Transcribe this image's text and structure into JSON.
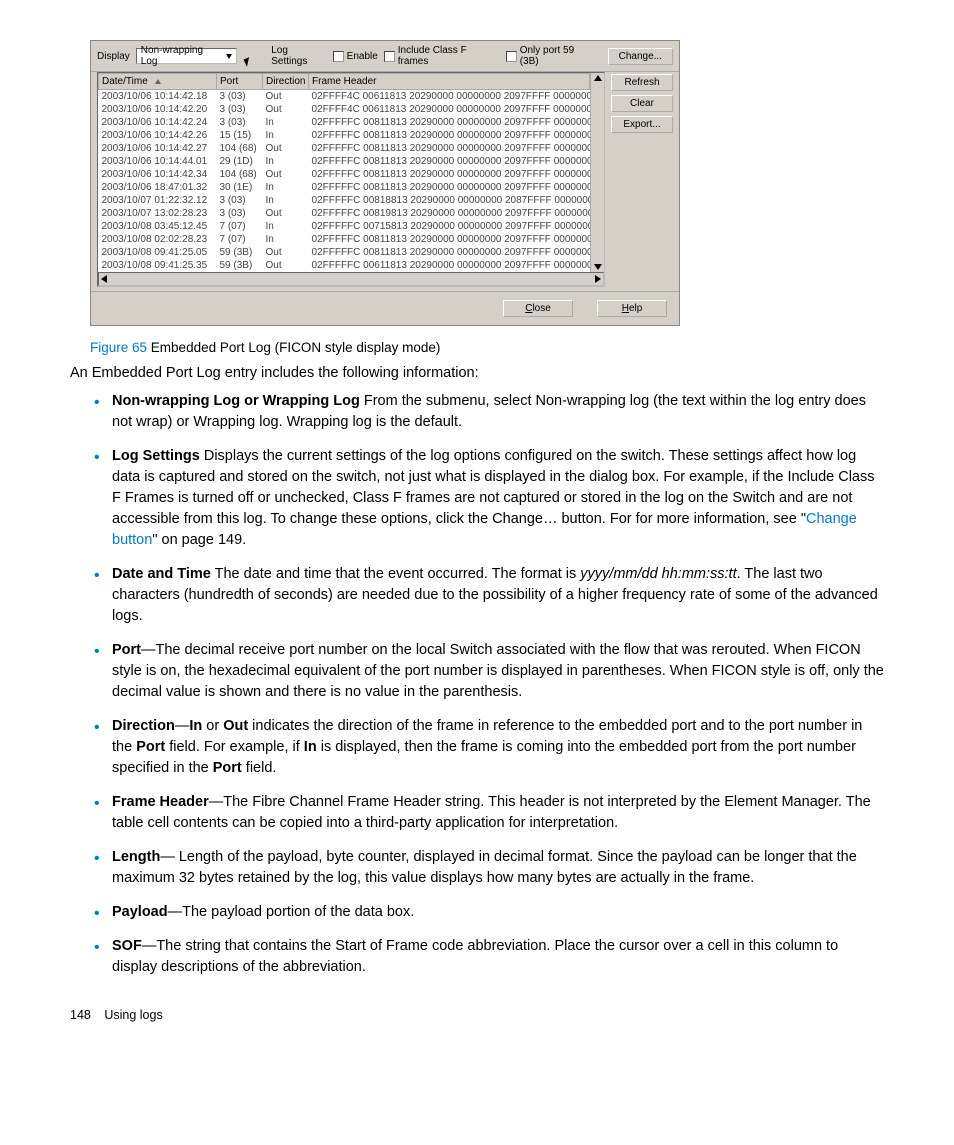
{
  "window": {
    "display_label": "Display",
    "dropdown": "Non-wrapping Log",
    "log_settings_label": "Log Settings",
    "enable_label": "Enable",
    "include_classf_label": "Include Class F frames",
    "only_port_label": "Only port 59 (3B)",
    "change_btn": "Change...",
    "columns": {
      "c0": "Date/Time",
      "c1": "Port",
      "c2": "Direction",
      "c3": "Frame Header"
    },
    "rows": [
      {
        "dt": "2003/10/06 10:14:42.18",
        "port": "3 (03)",
        "dir": "Out",
        "fh": "02FFFF4C 00611813 20290000 00000000 2097FFFF 0000000"
      },
      {
        "dt": "2003/10/06 10:14:42.20",
        "port": "3 (03)",
        "dir": "Out",
        "fh": "02FFFF4C 00611813 20290000 00000000 2097FFFF 0000000"
      },
      {
        "dt": "2003/10/06 10:14:42.24",
        "port": "3 (03)",
        "dir": "In",
        "fh": "02FFFFFC 00811813 20290000 00000000 2097FFFF 0000000"
      },
      {
        "dt": "2003/10/06 10:14:42.26",
        "port": "15 (15)",
        "dir": "In",
        "fh": "02FFFFFC 00811813 20290000 00000000 2097FFFF 0000000"
      },
      {
        "dt": "2003/10/06 10:14:42.27",
        "port": "104 (68)",
        "dir": "Out",
        "fh": "02FFFFFC 00811813 20290000 00000000 2097FFFF 0000000"
      },
      {
        "dt": "2003/10/06 10:14:44.01",
        "port": "29 (1D)",
        "dir": "In",
        "fh": "02FFFFFC 00811813 20290000 00000000 2097FFFF 0000000"
      },
      {
        "dt": "2003/10/06 10:14:42.34",
        "port": "104 (68)",
        "dir": "Out",
        "fh": "02FFFFFC 00811813 20290000 00000000 2097FFFF 0000000"
      },
      {
        "dt": "2003/10/06 18:47:01.32",
        "port": "30 (1E)",
        "dir": "In",
        "fh": "02FFFFFC 00811813 20290000 00000000 2097FFFF 0000000"
      },
      {
        "dt": "2003/10/07 01:22:32.12",
        "port": "3 (03)",
        "dir": "In",
        "fh": "02FFFFFC 00818813 20290000 00000000 2087FFFF 0000000"
      },
      {
        "dt": "2003/10/07 13:02:28.23",
        "port": "3 (03)",
        "dir": "Out",
        "fh": "02FFFFFC 00819813 20290000 00000000 2097FFFF 0000000"
      },
      {
        "dt": "2003/10/08 03:45:12.45",
        "port": "7 (07)",
        "dir": "In",
        "fh": "02FFFFFC 00715813 20290000 00000000 2097FFFF 0000000"
      },
      {
        "dt": "2003/10/08 02:02:28.23",
        "port": "7 (07)",
        "dir": "In",
        "fh": "02FFFFFC 00811813 20290000 00000000 2097FFFF 0000000"
      },
      {
        "dt": "2003/10/08 09:41:25.05",
        "port": "59 (3B)",
        "dir": "Out",
        "fh": "02FFFFFC 00811813 20290000 00000000 2097FFFF 0000000"
      },
      {
        "dt": "2003/10/08 09:41:25.35",
        "port": "59 (3B)",
        "dir": "Out",
        "fh": "02FFFFFC 00611813 20290000 00000000 2097FFFF 0000000"
      }
    ],
    "refresh_btn": "Refresh",
    "clear_btn": "Clear",
    "export_btn": "Export...",
    "close_btn": "Close",
    "help_btn": "Help"
  },
  "caption": {
    "prefix": "Figure 65",
    "text": "  Embedded Port Log (FICON style display mode)"
  },
  "intro": "An Embedded Port Log entry includes the following information:",
  "items": {
    "i0": {
      "term": "Non-wrapping Log or Wrapping Log",
      "sep": "   ",
      "body": "From the submenu, select Non-wrapping log (the text within the log entry does not wrap) or Wrapping log. Wrapping log is the default."
    },
    "i1": {
      "term": "Log Settings",
      "sep": "   ",
      "body_a": "Displays the current settings of the log options configured on the switch. These settings affect how log data is captured and stored on the switch, not just what is displayed in the dialog box. For example, if the Include Class F Frames is turned off or unchecked, Class F frames are not captured or stored in the log on the Switch and are not accessible from this log. To change these options, click the Change… button. For for more information, see \"",
      "link": "Change button",
      "body_b": "\" on page 149."
    },
    "i2": {
      "term": "Date and Time",
      "sep": "   ",
      "body_a": "The date and time that the event occurred. The format is ",
      "fmt": "yyyy/mm/dd hh:mm:ss:tt",
      "body_b": ". The last two characters (hundredth of seconds) are needed due to the possibility of a higher frequency rate of some of the advanced logs."
    },
    "i3": {
      "term": "Port",
      "sep": "—",
      "body": "The decimal receive port number on the local Switch associated with the flow that was rerouted. When FICON style is on, the hexadecimal equivalent of the port number is displayed in parentheses. When FICON style is off, only the decimal value is shown and there is no value in the parenthesis."
    },
    "i4": {
      "term": "Direction",
      "sep": "—",
      "body_a": "",
      "bold1": "In",
      "mid1": " or ",
      "bold2": "Out",
      "body_b": " indicates the direction of the frame in reference to the embedded port and to the port number in the ",
      "bold3": "Port",
      "body_c": " field. For example, if ",
      "bold4": "In",
      "body_d": " is displayed, then the frame is coming into the embedded port from the port number specified in the ",
      "bold5": "Port",
      "body_e": " field."
    },
    "i5": {
      "term": "Frame Header",
      "sep": "—",
      "body": "The Fibre Channel Frame Header string. This header is not interpreted by the Element Manager. The table cell contents can be copied into a third-party application for interpretation."
    },
    "i6": {
      "term": "Length",
      "sep": "— ",
      "body": "Length of the payload, byte counter, displayed in decimal format. Since the payload can be longer that the maximum 32 bytes retained by the log, this value displays how many bytes are actually in the frame."
    },
    "i7": {
      "term": "Payload",
      "sep": "—",
      "body": "The payload portion of the data box."
    },
    "i8": {
      "term": "SOF",
      "sep": "—",
      "body": "The string that contains the Start of Frame code abbreviation. Place the cursor over a cell in this column to display descriptions of the abbreviation."
    }
  },
  "footer": {
    "page": "148",
    "section": "Using logs"
  }
}
